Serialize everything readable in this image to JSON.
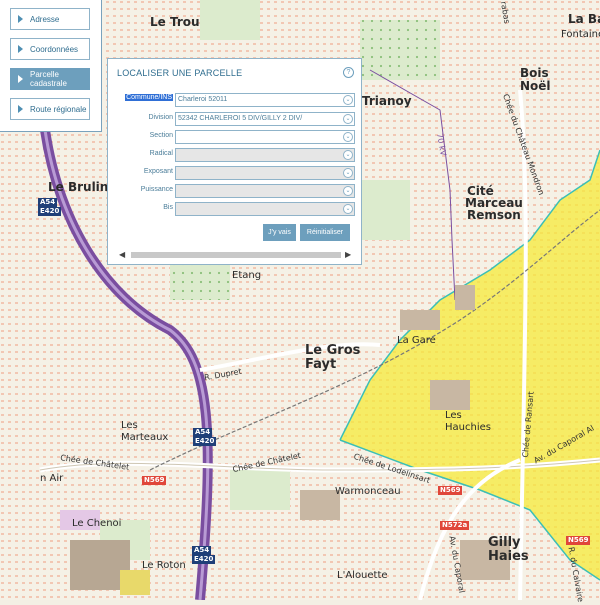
{
  "nav": {
    "items": [
      {
        "label": "Adresse",
        "active": false
      },
      {
        "label": "Coordonnées",
        "active": false
      },
      {
        "label": "Parcelle cadastrale",
        "active": true
      },
      {
        "label": "Route régionale",
        "active": false
      }
    ]
  },
  "panel": {
    "title": "LOCALISER UNE PARCELLE",
    "help_icon": "?",
    "fields": {
      "commune": {
        "label": "Commune/INS",
        "value": "Charleroi 52011"
      },
      "division": {
        "label": "Division",
        "value": "52342 CHARLEROI  5 DIV/GILLY  2 DIV/"
      },
      "section": {
        "label": "Section",
        "value": ""
      },
      "radical": {
        "label": "Radical",
        "value": ""
      },
      "exposant": {
        "label": "Exposant",
        "value": ""
      },
      "puissance": {
        "label": "Puissance",
        "value": ""
      },
      "bis": {
        "label": "Bis",
        "value": ""
      }
    },
    "buttons": {
      "go": "J'y vais",
      "reset": "Réinitialiser"
    }
  },
  "map": {
    "places": {
      "le_trou": "Le Trou",
      "trianoy": "Trianoy",
      "la_basse": "La Bas",
      "fontaine": "Fontaine",
      "bois_noel_1": "Bois",
      "bois_noel_2": "Noël",
      "cite_1": "Cité",
      "cite_2": "Marceau",
      "cite_3": "Remson",
      "le_brulin": "Le Brulin",
      "etang": "Etang",
      "le_gros": "Le Gros",
      "fayt": "Fayt",
      "la_gare": "La Gare",
      "les_marteaux_1": "Les",
      "les_marteaux_2": "Marteaux",
      "les_hauchies_1": "Les",
      "les_hauchies_2": "Hauchies",
      "warmonceau": "Warmonceau",
      "le_chenoi": "Le Chenoi",
      "le_roton": "Le Roton",
      "lalouette": "L'Alouette",
      "gilly_1": "Gilly",
      "gilly_2": "Haies",
      "n_air": "n Air"
    },
    "streets": {
      "chee_chatelet_1": "Chée de Châtelet",
      "chee_chatelet_2": "Chée de Châtelet",
      "chee_lodelinsart": "Chée de Lodelinsart",
      "r_dupret": "R. Dupret",
      "chee_chateau_mondron": "Chée du Château Mondron",
      "chee_ransart": "Chée de Ransart",
      "av_caporal": "Av. du Caporal Al",
      "av_caporal_2": "Av. du Caporal",
      "av_calvaire": "R. du Calvaire",
      "rabas": "rabas",
      "kv": "70 kV"
    },
    "shields": {
      "a54_top": "A54",
      "e420_top": "E420",
      "a54_mid": "A54",
      "e420_mid": "E420",
      "a54_bot": "A54",
      "e420_bot": "E420",
      "n569_a": "N569",
      "n569_b": "N569",
      "n572a": "N572a",
      "n569_c": "N569"
    }
  },
  "colors": {
    "accent": "#6d9fbd",
    "selected": "#2f6fd6",
    "zone": "#f5ea3a",
    "highway": "#7a4ea0"
  }
}
